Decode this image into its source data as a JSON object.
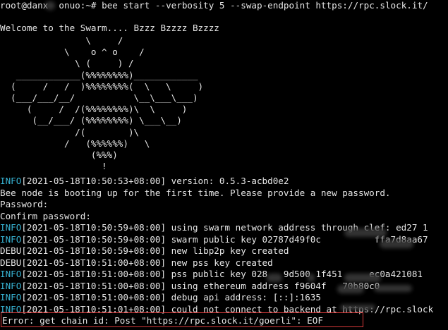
{
  "terminal": {
    "prompt_user": "root@danx",
    "prompt_host_tail": "onuo",
    "prompt_path": ":~#",
    "command": "bee start --verbosity 5 --swap-endpoint https://rpc.slock.it/",
    "welcome": "Welcome to the Swarm.... Bzzz Bzzzz Bzzzz",
    "ascii_art": "                \\     /\n            \\    o ^ o    /\n              \\ (     ) /\n   ____________(%%%%%%%%)____________\n  (     /   /  )%%%%%%%%(  \\   \\     )\n  (___/___/__/           \\__\\___\\___)\n     (     /  /(%%%%%%%%)\\  \\     )\n      (__/___/ (%%%%%%%%) \\___\\__)\n              /(        )\\\n            /   (%%%%%%)   \\\n                 (%%%)\n                   !",
    "log_lines": [
      {
        "level": "INFO",
        "timestamp": "[2021-05-18T10:50:53+08:00]",
        "message": " version: 0.5.3-acbd0e2"
      },
      {
        "level": "",
        "timestamp": "",
        "message": "Bee node is booting up for the first time. Please provide a new password."
      },
      {
        "level": "",
        "timestamp": "",
        "message": "Password:"
      },
      {
        "level": "",
        "timestamp": "",
        "message": "Confirm password:"
      },
      {
        "level": "INFO",
        "timestamp": "[2021-05-18T10:50:59+08:00]",
        "message": " using swarm network address through clef: ed27 1"
      },
      {
        "level": "INFO",
        "timestamp": "[2021-05-18T10:50:59+08:00]",
        "message": " swarm public key 02787d49f0c          ffa7d8aa67"
      },
      {
        "level": "DEBU",
        "timestamp": "[2021-05-18T10:50:59+08:00]",
        "message": " new libp2p key created"
      },
      {
        "level": "DEBU",
        "timestamp": "[2021-05-18T10:51:00+08:00]",
        "message": " new pss key created"
      },
      {
        "level": "INFO",
        "timestamp": "[2021-05-18T10:51:00+08:00]",
        "message": " pss public key 028   9d500 1f451     ec0a421081"
      },
      {
        "level": "INFO",
        "timestamp": "[2021-05-18T10:51:00+08:00]",
        "message": " using ethereum address f9604f   70b80c0"
      },
      {
        "level": "INFO",
        "timestamp": "[2021-05-18T10:51:00+08:00]",
        "message": " debug api address: [::]:1635"
      },
      {
        "level": "INFO",
        "timestamp": "[2021-05-18T10:51:01+08:00]",
        "message": " could not connect to backend at https://rpc.slock"
      }
    ],
    "error_line": "Error: get chain id: Post \"https://rpc.slock.it/goerli\": EOF"
  },
  "colors": {
    "background": "#000000",
    "foreground": "#e6e6e6",
    "info_level": "#37b3d3",
    "highlight_box": "#d83a3a"
  }
}
